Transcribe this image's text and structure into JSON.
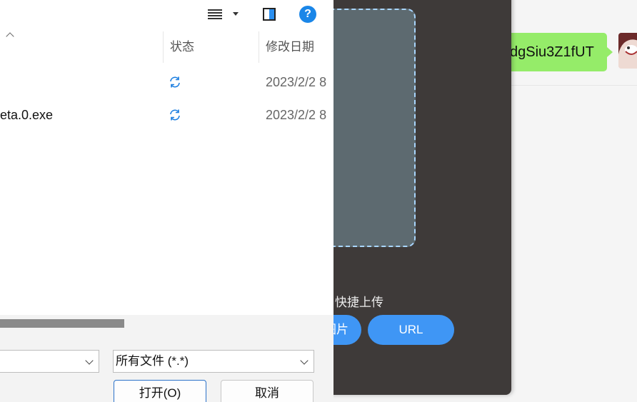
{
  "dialog": {
    "columns": {
      "status": "状态",
      "modified": "修改日期"
    },
    "files": [
      {
        "name": "",
        "date": "2023/2/2 8"
      },
      {
        "name": "eta.0.exe",
        "date": "2023/2/2 8"
      }
    ],
    "filename_value": "",
    "filetype_value": "所有文件 (*.*)",
    "open_label": "打开(O)",
    "cancel_label": "取消",
    "help_glyph": "?"
  },
  "upload": {
    "quick_upload_label": "快捷上传",
    "image_button_label": "图片",
    "url_button_label": "URL"
  },
  "chat": {
    "message_text": "dgSiu3Z1fUT"
  },
  "colors": {
    "accent_blue": "#3f96f5",
    "chat_bubble": "#95ec69",
    "dark_panel": "#3e3a39"
  }
}
